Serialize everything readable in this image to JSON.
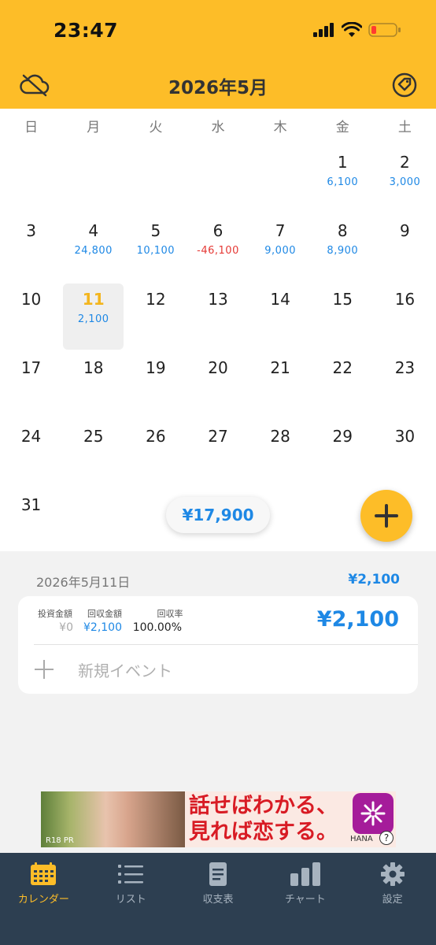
{
  "status_bar": {
    "time": "23:47"
  },
  "header": {
    "title": "2026年5月",
    "cloud_icon": "cloud-off-icon",
    "tag_icon": "tag-icon",
    "color": "#fdbd28"
  },
  "calendar": {
    "weekdays": [
      "日",
      "月",
      "火",
      "水",
      "木",
      "金",
      "土"
    ],
    "days": [
      {
        "day": "1",
        "amount": "6,100"
      },
      {
        "day": "2",
        "amount": "3,000"
      },
      {
        "day": "3",
        "amount": ""
      },
      {
        "day": "4",
        "amount": "24,800"
      },
      {
        "day": "5",
        "amount": "10,100"
      },
      {
        "day": "6",
        "amount": "-46,100"
      },
      {
        "day": "7",
        "amount": "9,000"
      },
      {
        "day": "8",
        "amount": "8,900"
      },
      {
        "day": "9",
        "amount": ""
      },
      {
        "day": "10",
        "amount": ""
      },
      {
        "day": "11",
        "amount": "2,100"
      },
      {
        "day": "12",
        "amount": ""
      },
      {
        "day": "13",
        "amount": ""
      },
      {
        "day": "14",
        "amount": ""
      },
      {
        "day": "15",
        "amount": ""
      },
      {
        "day": "16",
        "amount": ""
      },
      {
        "day": "17",
        "amount": ""
      },
      {
        "day": "18",
        "amount": ""
      },
      {
        "day": "19",
        "amount": ""
      },
      {
        "day": "20",
        "amount": ""
      },
      {
        "day": "21",
        "amount": ""
      },
      {
        "day": "22",
        "amount": ""
      },
      {
        "day": "23",
        "amount": ""
      },
      {
        "day": "24",
        "amount": ""
      },
      {
        "day": "25",
        "amount": ""
      },
      {
        "day": "26",
        "amount": ""
      },
      {
        "day": "27",
        "amount": ""
      },
      {
        "day": "28",
        "amount": ""
      },
      {
        "day": "29",
        "amount": ""
      },
      {
        "day": "30",
        "amount": ""
      },
      {
        "day": "31",
        "amount": ""
      }
    ],
    "first_weekday": 5,
    "selected_day": "11",
    "month_total": "¥17,900",
    "positive_color": "#1e88e5",
    "negative_color": "#e53935"
  },
  "detail": {
    "date": "2026年5月11日",
    "total": "¥2,100",
    "card": {
      "invest_label": "投資金額",
      "invest_value": "¥0",
      "return_label": "回収金額",
      "return_value": "¥2,100",
      "rate_label": "回収率",
      "rate_value": "100.00%",
      "amount": "¥2,100"
    },
    "new_event_label": "新規イベント"
  },
  "ad": {
    "headline_line1": "話せばわかる、",
    "headline_line2": "見れば恋する。",
    "photo_tag": "R18 PR",
    "brand": "HANA",
    "help": "?"
  },
  "tabbar": {
    "tabs": [
      {
        "label": "カレンダー",
        "icon": "calendar-icon",
        "active": true
      },
      {
        "label": "リスト",
        "icon": "list-icon",
        "active": false
      },
      {
        "label": "収支表",
        "icon": "document-icon",
        "active": false
      },
      {
        "label": "チャート",
        "icon": "bar-chart-icon",
        "active": false
      },
      {
        "label": "設定",
        "icon": "gear-icon",
        "active": false
      }
    ]
  }
}
